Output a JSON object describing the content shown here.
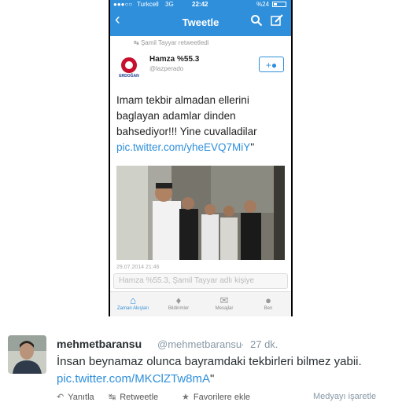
{
  "phone": {
    "status_bar": {
      "carrier": "Turkcell",
      "network": "3G",
      "time": "22:42",
      "battery": "%24"
    },
    "nav": {
      "title": "Tweetle",
      "back_icon": "chevron-left-icon",
      "search_icon": "search-icon",
      "compose_icon": "compose-icon"
    },
    "retweet_line": "Şamil Tayyar retweetledi",
    "tweet": {
      "display_name": "Hamza %55.3",
      "handle": "@lazperado",
      "avatar_text": "ERDOĞAN",
      "text_lines": [
        "Imam tekbir almadan ellerini",
        "baglayan adamlar dinden",
        "bahsediyor!!! Yine cuvalladilar"
      ],
      "link": "pic.twitter.com/yheEVQ7MiY",
      "link_suffix": "\"",
      "date": "29.07.2014 21:46"
    },
    "reply_placeholder": "Hamza %55.3, Şamil Tayyar adlı kişiye",
    "tabs": [
      {
        "label": "Zaman Akışları",
        "icon": "home-icon",
        "active": true
      },
      {
        "label": "Bildirimler",
        "icon": "bell-icon",
        "active": false
      },
      {
        "label": "Mesajlar",
        "icon": "envelope-icon",
        "active": false
      },
      {
        "label": "Ben",
        "icon": "person-icon",
        "active": false
      }
    ]
  },
  "outer_tweet": {
    "name": "mehmetbaransu",
    "handle": "@mehmetbaransu",
    "separator": "·",
    "time": "27 dk.",
    "text": "İnsan beynamaz olunca bayramdaki tekbirleri bilmez yabii.",
    "link": "pic.twitter.com/MKClZTw8mA",
    "link_suffix": "\"",
    "actions": {
      "reply": "Yanıtla",
      "retweet": "Retweetle",
      "favorite": "Favorilere ekle"
    },
    "media_link": "Medyayı işaretle"
  },
  "colors": {
    "twitter_blue": "#2f8fdb",
    "link": "#2f8fdb",
    "muted": "#8899a6"
  }
}
